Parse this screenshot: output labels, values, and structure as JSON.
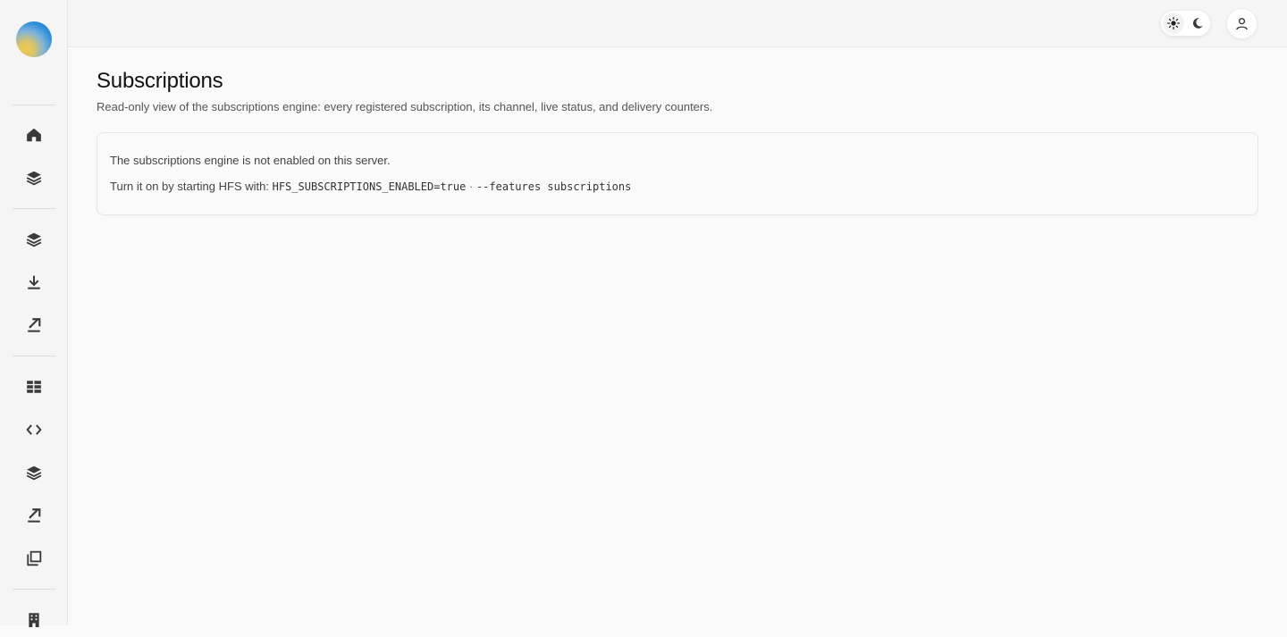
{
  "page": {
    "title": "Subscriptions",
    "subtitle": "Read-only view of the subscriptions engine: every registered subscription, its channel, live status, and delivery counters."
  },
  "notice": {
    "message": "The subscriptions engine is not enabled on this server.",
    "hint_prefix": "Turn it on by starting HFS with:",
    "env_var": "HFS_SUBSCRIPTIONS_ENABLED=true",
    "separator": "·",
    "cli_flag": "--features subscriptions"
  },
  "sidebar": {
    "icons": [
      "home-icon",
      "layers-icon",
      "layers-icon",
      "download-icon",
      "export-icon",
      "table-grid-icon",
      "code-icon",
      "layers-icon",
      "export-icon",
      "copy-icon",
      "building-icon"
    ]
  },
  "topbar": {
    "theme_options": [
      "sun-icon",
      "moon-icon"
    ],
    "account_icon": "user-icon"
  },
  "colors": {
    "background": "#fafafa",
    "sidebar_bg": "#f5f5f5",
    "border": "#e6e6e6",
    "icon": "#3a3a3a"
  }
}
